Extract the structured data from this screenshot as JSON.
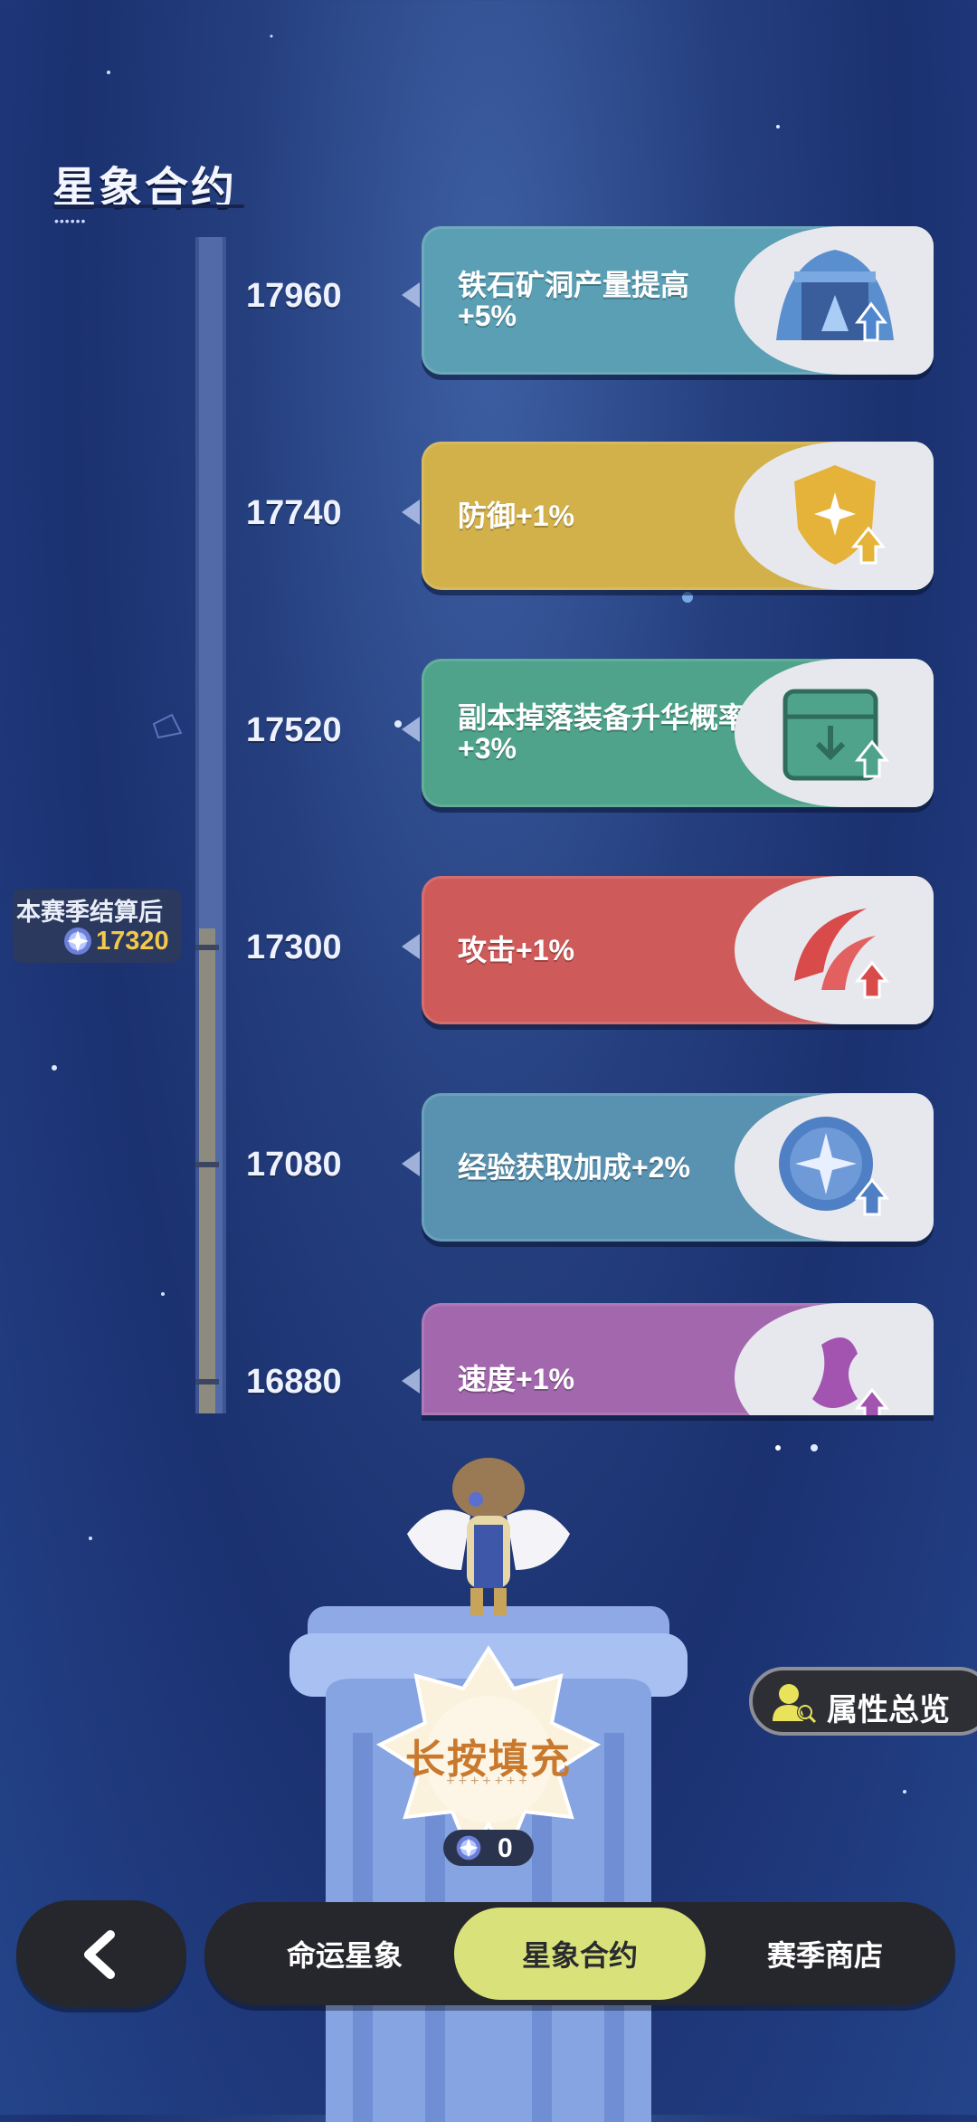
{
  "page": {
    "title": "星象合约"
  },
  "milestones": [
    {
      "score": "17960",
      "reward": "铁石矿洞产量提高+5%",
      "icon": "mine-upgrade-icon",
      "color": "#5a9fb3"
    },
    {
      "score": "17740",
      "reward": "防御+1%",
      "icon": "defense-shield-icon",
      "color": "#d2b04a"
    },
    {
      "score": "17520",
      "reward": "副本掉落装备升华概率+3%",
      "icon": "loot-box-icon",
      "color": "#4ea38a"
    },
    {
      "score": "17300",
      "reward": "攻击+1%",
      "icon": "attack-slash-icon",
      "color": "#cf5a5a"
    },
    {
      "score": "17080",
      "reward": "经验获取加成+2%",
      "icon": "exp-star-icon",
      "color": "#5892b0"
    },
    {
      "score": "16880",
      "reward": "速度+1%",
      "icon": "speed-icon",
      "color": "#a267ad"
    }
  ],
  "season": {
    "label": "本赛季结算后",
    "value": "17320",
    "icon": "star-gem-icon"
  },
  "fill": {
    "label": "长按填充",
    "decoration": "+++++++",
    "count": "0"
  },
  "attributes_button": {
    "label": "属性总览",
    "icon": "person-search-icon"
  },
  "nav": {
    "back_icon": "chevron-left-icon",
    "tabs": [
      "命运星象",
      "星象合约",
      "赛季商店"
    ],
    "active_index": 1
  }
}
